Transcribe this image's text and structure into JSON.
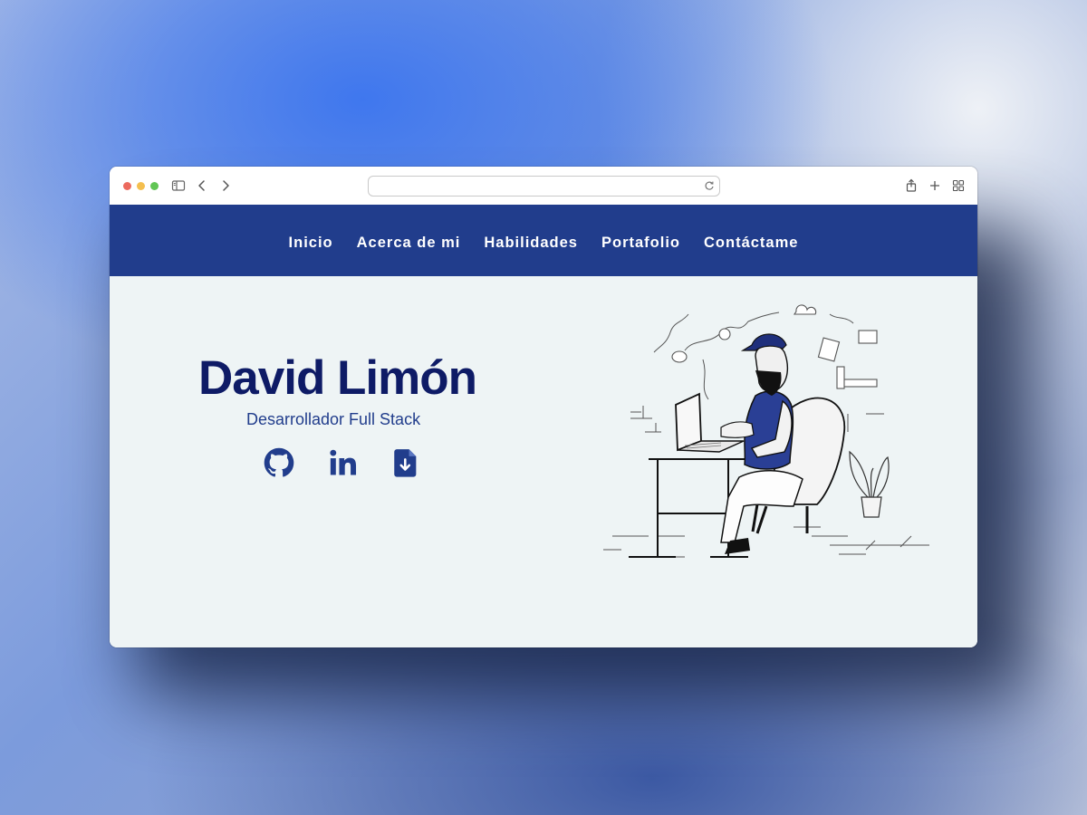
{
  "browser": {
    "url": "",
    "icons": [
      "sidebar-icon",
      "back-icon",
      "forward-icon",
      "reload-icon",
      "share-icon",
      "new-tab-icon",
      "tab-overview-icon"
    ]
  },
  "nav": {
    "items": [
      "Inicio",
      "Acerca de mi",
      "Habilidades",
      "Portafolio",
      "Contáctame"
    ]
  },
  "hero": {
    "name": "David Limón",
    "role": "Desarrollador Full Stack",
    "social_icons": [
      "github-icon",
      "linkedin-icon",
      "download-cv-icon"
    ]
  },
  "colors": {
    "nav_background": "#213d8c",
    "page_background": "#eef4f5",
    "name_color": "#0e1b66",
    "accent": "#213d8c"
  }
}
